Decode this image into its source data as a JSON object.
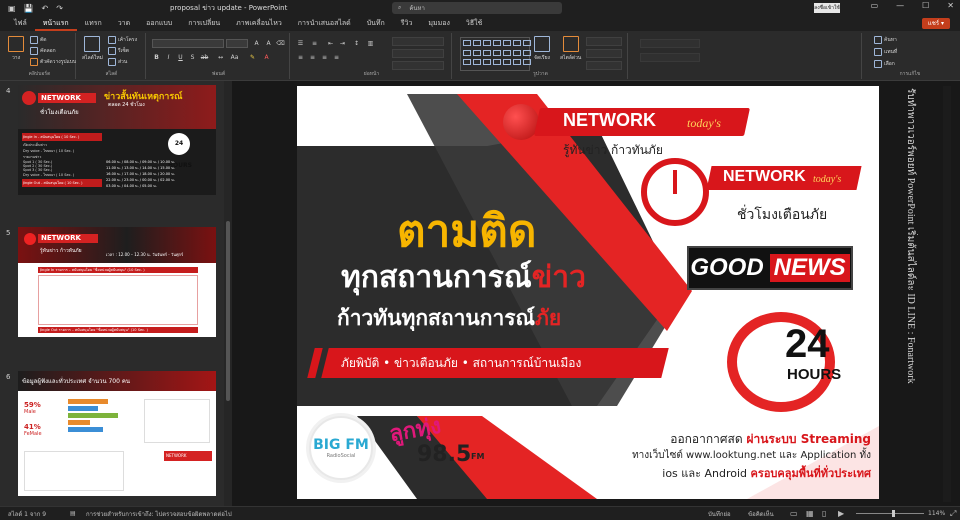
{
  "window": {
    "title": "proposal ข่าว update  -  PowerPoint",
    "search_placeholder": "ค้นหา",
    "account_label": "ลงชื่อเข้าใช้",
    "quick_access": [
      "💾",
      "↶",
      "↷",
      "▣"
    ]
  },
  "tabs": [
    {
      "label": "ไฟล์"
    },
    {
      "label": "หน้าแรก",
      "active": true
    },
    {
      "label": "แทรก"
    },
    {
      "label": "วาด"
    },
    {
      "label": "ออกแบบ"
    },
    {
      "label": "การเปลี่ยน"
    },
    {
      "label": "ภาพเคลื่อนไหว"
    },
    {
      "label": "การนำเสนอสไลด์"
    },
    {
      "label": "บันทึก"
    },
    {
      "label": "รีวิว"
    },
    {
      "label": "มุมมอง"
    },
    {
      "label": "วิธีใช้"
    }
  ],
  "share_label": "แชร์ ▾",
  "ribbon": {
    "clipboard": {
      "paste": "วาง",
      "cut": "ตัด",
      "copy": "คัดลอก",
      "format_painter": "ตัวคัดวางรูปแบบ",
      "label": "คลิปบอร์ด"
    },
    "slides": {
      "new_slide": "สไลด์ใหม่",
      "layout": "เค้าโครง",
      "reset": "รีเซ็ต",
      "section": "ส่วน",
      "label": "สไลด์"
    },
    "font": {
      "label": "ฟอนต์"
    },
    "paragraph": {
      "label": "ย่อหน้า"
    },
    "drawing": {
      "arrange": "จัดเรียง",
      "quick_styles": "สไตล์ด่วน",
      "label": "รูปวาด"
    },
    "editing": {
      "find": "ค้นหา",
      "replace": "แทนที่",
      "select": "เลือก",
      "label": "การแก้ไข"
    }
  },
  "thumbnails": [
    {
      "number": "4",
      "brand": "NETWORK",
      "brand_suffix": "today's",
      "subtitle": "ชั่วโมงเตือนภัย",
      "headline": "ข่าวสั้นทันเหตุการณ์",
      "headline2": "ตลอด 24 ชั่วโมง",
      "badge": "24 HOURS",
      "rows": [
        "Jingle In - สนับสนุนโดย ( 10 Sec. )",
        "เปิดประเด็นข่าว",
        "Dry voice - โฆษณา ( 10 Sec. )",
        "รายงานข่าว",
        "Spot 1 ( 30 Sec.)",
        "Spot 2 ( 30 Sec.)",
        "Spot 3 ( 30 Sec.)",
        "Dry voice - โฆษณา ( 10 Sec. )",
        "Jingle Out - สนับสนุนโดย ( 10 Sec. )"
      ],
      "times": [
        "06.00 น. / 08.00 น. / 09.00 น. / 10.00 น.",
        "11.00 น. / 13.00 น. / 14.00 น. / 15.00 น.",
        "16.00 น. / 17.00 น. / 18.00 น. / 20.00 น.",
        "22.00 น. / 23.00 น. / 00.00 น. / 02.00 น.",
        "03.00 น. / 04.00 น. / 05.00 น."
      ]
    },
    {
      "number": "5",
      "brand": "NETWORK",
      "brand_suffix": "today's",
      "subtitle": "รู้ทันข่าว ก้าวทันภัย",
      "schedule": "เวลา : 12.00 – 12.30 น. วันจันทร์ - วันศุกร์",
      "jingle_in": "Jingle In รายการ – สนับสนุนโดย \"ชื่อหน่วยผู้สนับสนุน\" (10 Sec. )",
      "jingle_out": "Jingle Out รายการ – สนับสนุนโดย \"ชื่อหน่วยผู้สนับสนุน\" (10 Sec. )"
    },
    {
      "number": "6",
      "headline": "ข้อมูลผู้ฟังและทั่วประเทศ จำนวน 700 คน",
      "male_pct": "59%",
      "male_label": "Male",
      "female_pct": "41%",
      "female_label": "FeMale",
      "brand": "NETWORK"
    }
  ],
  "main_slide": {
    "brand1": "NETWORK",
    "brand1_suffix": "today's",
    "tagline1": "รู้ทันข่าว ก้าวทันภัย",
    "brand2": "NETWORK",
    "brand2_suffix": "today's",
    "tagline2": "ชั่วโมงเตือนภัย",
    "good": "GOOD",
    "news": "NEWS",
    "headline_yellow": "ตามติด",
    "headline_white1": "ทุกสถานการณ์",
    "headline_red1": "ข่าว",
    "headline_white2": "ก้าวทันทุกสถานการณ์",
    "headline_red2": "ภัย",
    "banner": "ภัยพิบัติ • ข่าวเตือนภัย • สถานการณ์บ้านเมือง",
    "badge_24": "24",
    "badge_hours": "HOURS",
    "bigfm": "BIG FM",
    "bigfm_sub": "RadioSocial",
    "lookthung": "ลูกทุ่ง",
    "lookthung_freq": "98.5",
    "lookthung_fm": "FM",
    "info1_prefix": "ออกอากาศสด ",
    "info1_highlight": "ผ่านระบบ Streaming",
    "info2": "ทางเว็บไซต์ www.looktung.net และ Application ทั้ง",
    "info3_prefix": "ios และ Android ",
    "info3_highlight": "ครอบคลุมพื้นที่ทั่วประเทศ"
  },
  "right_note": "รับทำพาวเวอร์พอยท์ PowerPoint เริ่มต้นสไลด์ละ ID LINE : Fonartwork",
  "statusbar": {
    "slide_info": "สไลด์ 1 จาก 9",
    "accessibility": "การช่วยสำหรับการเข้าถึง: ไปตรวจสอบข้อผิดพลาดต่อไป",
    "notes": "บันทึกย่อ",
    "comments": "ข้อคิดเห็น",
    "zoom": "114%"
  },
  "colors": {
    "accent": "#c43e1c",
    "brand_red": "#e42424",
    "dark": "#2a2a2a",
    "yellow": "#f7b500"
  }
}
